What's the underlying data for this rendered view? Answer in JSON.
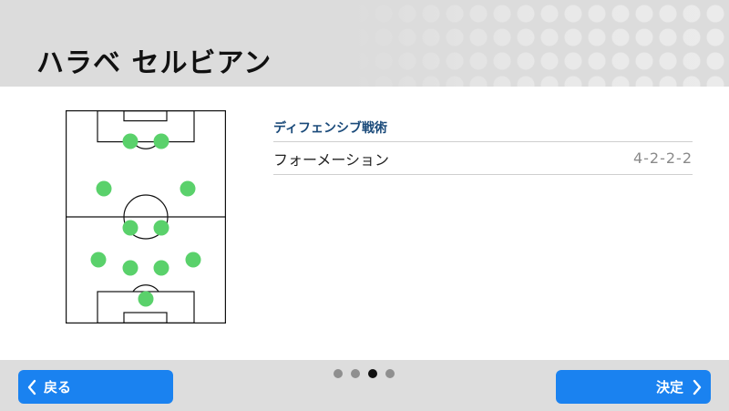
{
  "header": {
    "title": "ハラベ セルビアン"
  },
  "tactics": {
    "section_title": "ディフェンシブ戦術",
    "rows": [
      {
        "label": "フォーメーション",
        "value": "4-2-2-2"
      }
    ]
  },
  "pitch": {
    "players": [
      "GK",
      "DF",
      "DF",
      "DF",
      "DF",
      "MF",
      "MF",
      "MF",
      "MF",
      "FW",
      "FW"
    ]
  },
  "pagination": {
    "total": 4,
    "current": 3
  },
  "footer": {
    "back_label": "戻る",
    "confirm_label": "決定"
  },
  "colors": {
    "accent": "#1a82f0",
    "player": "#5ad16b",
    "section_title": "#1a4a7a"
  }
}
